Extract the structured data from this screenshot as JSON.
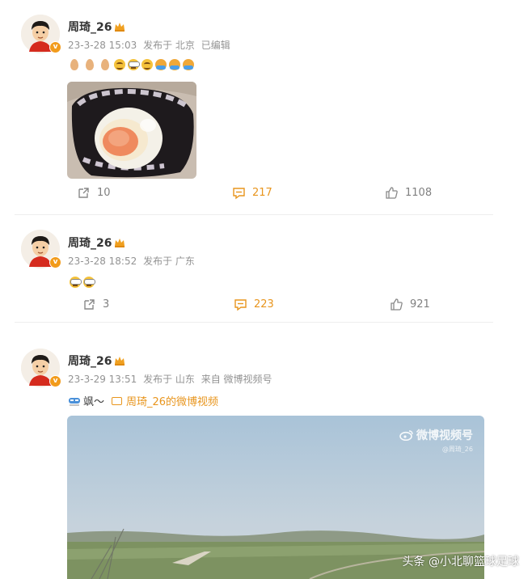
{
  "posts": [
    {
      "username": "周琦_26",
      "meta": {
        "date": "23-3-28 15:03",
        "location": "发布于 北京",
        "edited": "已编辑"
      },
      "emojis": [
        "egg",
        "egg",
        "egg",
        "smile",
        "cry",
        "smile",
        "hug",
        "hug",
        "hug"
      ],
      "actions": {
        "repost": "10",
        "comment": "217",
        "like": "1108"
      }
    },
    {
      "username": "周琦_26",
      "meta": {
        "date": "23-3-28 18:52",
        "location": "发布于 广东"
      },
      "emojis": [
        "cry",
        "cry"
      ],
      "actions": {
        "repost": "3",
        "comment": "223",
        "like": "921"
      }
    },
    {
      "username": "周琦_26",
      "meta": {
        "date": "23-3-29 13:51",
        "location": "发布于 山东",
        "source": "来自 微博视频号"
      },
      "text": {
        "main": "飒～",
        "link": "周琦_26的微博视频"
      },
      "video": {
        "watermark": "微博视频号",
        "watermark_sub": "@周琦_26"
      },
      "actions": {}
    }
  ],
  "overlay": {
    "toutiao": "头条 @小北聊篮球足球"
  },
  "colors": {
    "accent": "#e8951d",
    "meta_gray": "#939393",
    "verified": "#f29b1b"
  }
}
